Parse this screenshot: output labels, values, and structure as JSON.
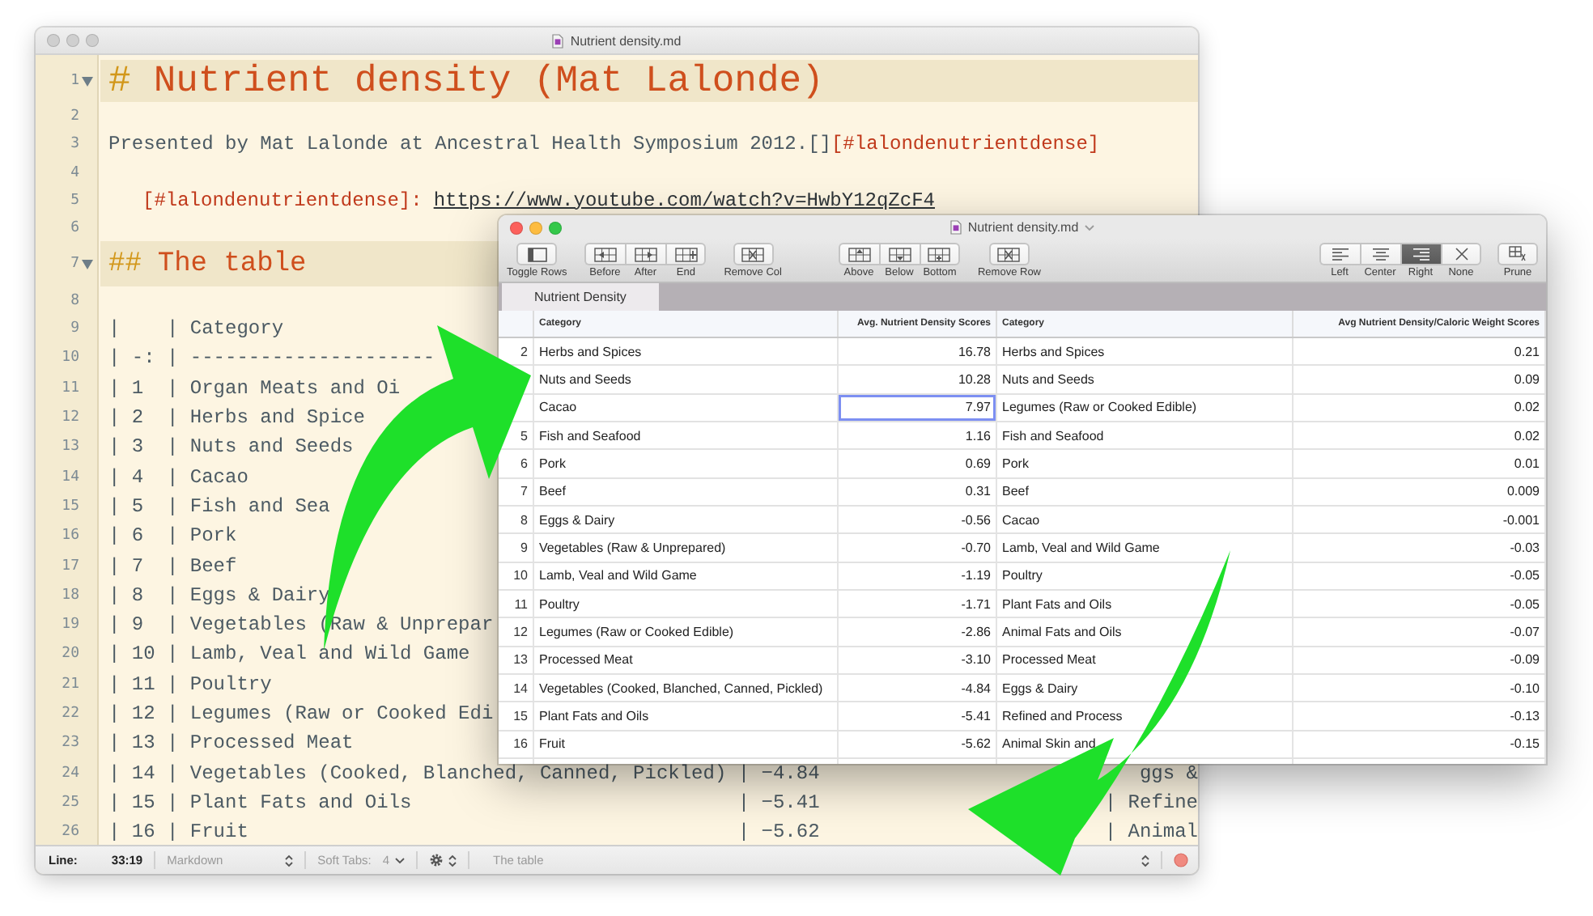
{
  "editor": {
    "title": "Nutrient density.md",
    "lines": [
      {
        "number": "1",
        "kind": "h1",
        "parts": [
          {
            "text": "#"
          },
          {
            "text": "Nutrient density (Mat Lalonde)"
          }
        ]
      },
      {
        "number": "2",
        "kind": "blank"
      },
      {
        "number": "3",
        "kind": "text",
        "parts": [
          {
            "text": "Presented by Mat Lalonde at Ancestral Health Symposium 2012.[]"
          },
          {
            "text": "[#lalondenutrientdense]"
          }
        ]
      },
      {
        "number": "4",
        "kind": "blank"
      },
      {
        "number": "5",
        "kind": "reference",
        "parts": [
          {
            "text": "[#lalondenutrientdense]:"
          },
          {
            "text": "https://www.youtube.com/watch?v=HwbY12qZcF4"
          }
        ]
      },
      {
        "number": "6",
        "kind": "blank"
      },
      {
        "number": "7",
        "kind": "h2",
        "parts": [
          {
            "text": "##"
          },
          {
            "text": "The table"
          }
        ]
      },
      {
        "number": "8",
        "kind": "blank"
      },
      {
        "number": "9",
        "kind": "table",
        "parts": [
          {
            "text": "|    | Category"
          }
        ]
      },
      {
        "number": "10",
        "kind": "table",
        "parts": [
          {
            "text": "| -: | ---------------------"
          }
        ]
      },
      {
        "number": "11",
        "kind": "table",
        "parts": [
          {
            "text": "| 1  | Organ Meats and Oi"
          }
        ]
      },
      {
        "number": "12",
        "kind": "table",
        "parts": [
          {
            "text": "| 2  | Herbs and Spice"
          }
        ]
      },
      {
        "number": "13",
        "kind": "table",
        "parts": [
          {
            "text": "| 3  | Nuts and Seeds"
          }
        ]
      },
      {
        "number": "14",
        "kind": "table",
        "parts": [
          {
            "text": "| 4  | Cacao"
          }
        ]
      },
      {
        "number": "15",
        "kind": "table",
        "parts": [
          {
            "text": "| 5  | Fish and Sea"
          }
        ]
      },
      {
        "number": "16",
        "kind": "table",
        "parts": [
          {
            "text": "| 6  | Pork"
          }
        ]
      },
      {
        "number": "17",
        "kind": "table",
        "parts": [
          {
            "text": "| 7  | Beef"
          }
        ]
      },
      {
        "number": "18",
        "kind": "table",
        "parts": [
          {
            "text": "| 8  | Eggs & Dairy"
          }
        ]
      },
      {
        "number": "19",
        "kind": "table",
        "parts": [
          {
            "text": "| 9  | Vegetables (Raw & Unprepar"
          }
        ]
      },
      {
        "number": "20",
        "kind": "table",
        "parts": [
          {
            "text": "| 10 | Lamb, Veal and Wild Game"
          }
        ]
      },
      {
        "number": "21",
        "kind": "table",
        "parts": [
          {
            "text": "| 11 | Poultry"
          }
        ]
      },
      {
        "number": "22",
        "kind": "table",
        "parts": [
          {
            "text": "| 12 | Legumes (Raw or Cooked Edi"
          }
        ]
      },
      {
        "number": "23",
        "kind": "table",
        "parts": [
          {
            "text": "| 13 | Processed Meat"
          }
        ]
      },
      {
        "number": "24",
        "kind": "table",
        "parts": [
          {
            "text": "| 14 | Vegetables (Cooked, Blanched, Canned, Pickled) | −4.84"
          },
          {
            "text": "ggs &"
          }
        ]
      },
      {
        "number": "25",
        "kind": "table",
        "parts": [
          {
            "text": "| 15 | Plant Fats and Oils                            | −5.41"
          },
          {
            "text": "| Refine"
          }
        ]
      },
      {
        "number": "26",
        "kind": "table",
        "parts": [
          {
            "text": "| 16 | Fruit                                          | −5.62"
          },
          {
            "text": "| Animal"
          }
        ]
      }
    ],
    "status_bar": {
      "line_label": "Line:",
      "position": "33:19",
      "syntax": "Markdown",
      "tabs_label": "Soft Tabs:",
      "tab_size": "4",
      "symbol": "The table"
    }
  },
  "table_window": {
    "title": "Nutrient density.md",
    "toolbar": [
      {
        "groups": [
          {
            "buttons": [
              {
                "label": "Toggle Rows",
                "kind": "toggle"
              }
            ]
          },
          {
            "buttons": [
              {
                "label": "Before",
                "kind": "col-before"
              },
              {
                "label": "After",
                "kind": "col-after"
              },
              {
                "label": "End",
                "kind": "col-end"
              }
            ]
          },
          {
            "buttons": [
              {
                "label": "Remove Col",
                "kind": "remove"
              }
            ]
          }
        ]
      },
      {
        "groups": [
          {
            "buttons": [
              {
                "label": "Above",
                "kind": "row-above"
              },
              {
                "label": "Below",
                "kind": "row-below"
              },
              {
                "label": "Bottom",
                "kind": "row-bottom"
              }
            ]
          },
          {
            "buttons": [
              {
                "label": "Remove Row",
                "kind": "remove"
              }
            ]
          }
        ]
      },
      {
        "groups": [
          {
            "buttons": [
              {
                "label": "Left",
                "kind": "align-left",
                "selected": false
              },
              {
                "label": "Center",
                "kind": "align-center",
                "selected": false
              },
              {
                "label": "Right",
                "kind": "align-right",
                "selected": true
              },
              {
                "label": "None",
                "kind": "none",
                "selected": false
              }
            ]
          },
          {
            "buttons": [
              {
                "label": "Prune",
                "kind": "prune"
              }
            ]
          }
        ]
      }
    ],
    "tabs": [
      {
        "label": "Nutrient Density",
        "selected": true
      }
    ],
    "columns": [
      "Category",
      "Avg. Nutrient Density Scores",
      "Category",
      "Avg Nutrient Density/Caloric Weight Scores"
    ],
    "rows": [
      {
        "number": "2",
        "cells": [
          {
            "text": "Herbs and Spices",
            "selected": false
          },
          {
            "text": "16.78",
            "selected": false
          },
          {
            "text": "Herbs and Spices",
            "selected": false
          },
          {
            "text": "0.21",
            "selected": false
          }
        ]
      },
      {
        "cells": [
          {
            "text": "Nuts and Seeds",
            "selected": false
          },
          {
            "text": "10.28",
            "selected": false
          },
          {
            "text": "Nuts and Seeds",
            "selected": false
          },
          {
            "text": "0.09",
            "selected": false
          }
        ]
      },
      {
        "cells": [
          {
            "text": "Cacao",
            "selected": false
          },
          {
            "text": "7.97",
            "selected": true
          },
          {
            "text": "Legumes (Raw or Cooked Edible)",
            "selected": false
          },
          {
            "text": "0.02",
            "selected": false
          }
        ]
      },
      {
        "number": "5",
        "cells": [
          {
            "text": "Fish and Seafood",
            "selected": false
          },
          {
            "text": "1.16",
            "selected": false
          },
          {
            "text": "Fish and Seafood",
            "selected": false
          },
          {
            "text": "0.02",
            "selected": false
          }
        ]
      },
      {
        "number": "6",
        "cells": [
          {
            "text": "Pork",
            "selected": false
          },
          {
            "text": "0.69",
            "selected": false
          },
          {
            "text": "Pork",
            "selected": false
          },
          {
            "text": "0.01",
            "selected": false
          }
        ]
      },
      {
        "number": "7",
        "cells": [
          {
            "text": "Beef",
            "selected": false
          },
          {
            "text": "0.31",
            "selected": false
          },
          {
            "text": "Beef",
            "selected": false
          },
          {
            "text": "0.009",
            "selected": false
          }
        ]
      },
      {
        "number": "8",
        "cells": [
          {
            "text": "Eggs & Dairy",
            "selected": false
          },
          {
            "text": "-0.56",
            "selected": false
          },
          {
            "text": "Cacao",
            "selected": false
          },
          {
            "text": "-0.001",
            "selected": false
          }
        ]
      },
      {
        "number": "9",
        "cells": [
          {
            "text": "Vegetables (Raw & Unprepared)",
            "selected": false
          },
          {
            "text": "-0.70",
            "selected": false
          },
          {
            "text": "Lamb, Veal and Wild Game",
            "selected": false
          },
          {
            "text": "-0.03",
            "selected": false
          }
        ]
      },
      {
        "number": "10",
        "cells": [
          {
            "text": "Lamb, Veal and Wild Game",
            "selected": false
          },
          {
            "text": "-1.19",
            "selected": false
          },
          {
            "text": "Poultry",
            "selected": false
          },
          {
            "text": "-0.05",
            "selected": false
          }
        ]
      },
      {
        "number": "11",
        "cells": [
          {
            "text": "Poultry",
            "selected": false
          },
          {
            "text": "-1.71",
            "selected": false
          },
          {
            "text": "Plant Fats and Oils",
            "selected": false
          },
          {
            "text": "-0.05",
            "selected": false
          }
        ]
      },
      {
        "number": "12",
        "cells": [
          {
            "text": "Legumes (Raw or Cooked Edible)",
            "selected": false
          },
          {
            "text": "-2.86",
            "selected": false
          },
          {
            "text": "Animal Fats and Oils",
            "selected": false
          },
          {
            "text": "-0.07",
            "selected": false
          }
        ]
      },
      {
        "number": "13",
        "cells": [
          {
            "text": "Processed Meat",
            "selected": false
          },
          {
            "text": "-3.10",
            "selected": false
          },
          {
            "text": "Processed Meat",
            "selected": false
          },
          {
            "text": "-0.09",
            "selected": false
          }
        ]
      },
      {
        "number": "14",
        "cells": [
          {
            "text": "Vegetables (Cooked, Blanched, Canned, Pickled)",
            "selected": false
          },
          {
            "text": "-4.84",
            "selected": false
          },
          {
            "text": "Eggs & Dairy",
            "selected": false
          },
          {
            "text": "-0.10",
            "selected": false
          }
        ]
      },
      {
        "number": "15",
        "cells": [
          {
            "text": "Plant Fats and Oils",
            "selected": false
          },
          {
            "text": "-5.41",
            "selected": false
          },
          {
            "text": "Refined and Process",
            "selected": false
          },
          {
            "text": "-0.13",
            "selected": false
          }
        ]
      },
      {
        "number": "16",
        "cells": [
          {
            "text": "Fruit",
            "selected": false
          },
          {
            "text": "-5.62",
            "selected": false
          },
          {
            "text": "Animal Skin and",
            "selected": false
          },
          {
            "text": "-0.15",
            "selected": false
          }
        ]
      }
    ]
  }
}
